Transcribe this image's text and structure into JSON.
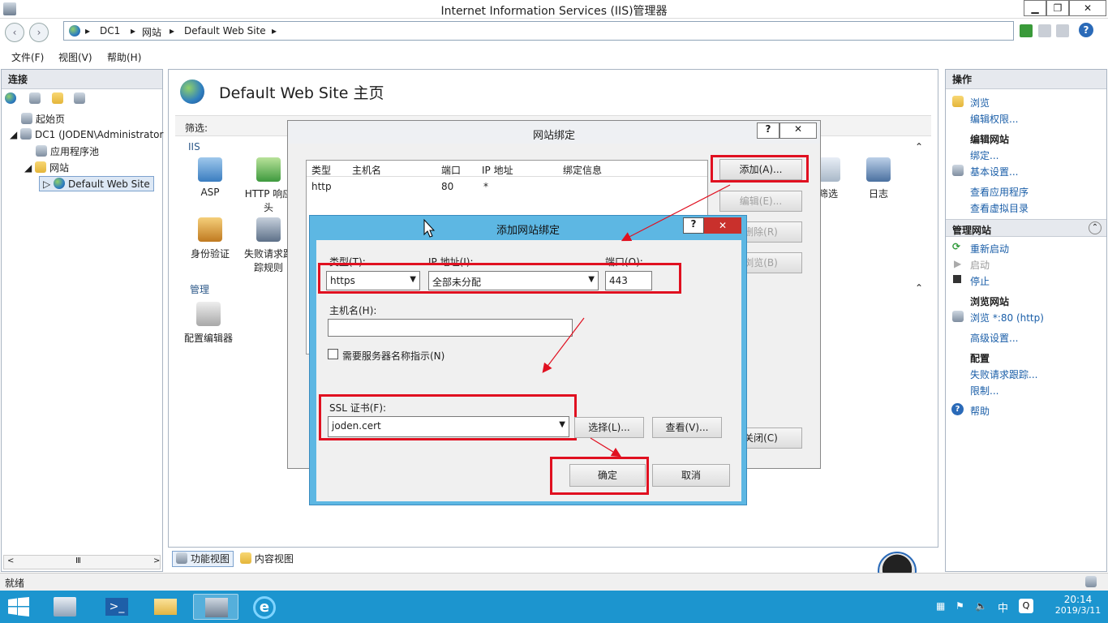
{
  "window": {
    "title": "Internet Information Services (IIS)管理器"
  },
  "address": {
    "crumbs": [
      "DC1",
      "网站",
      "Default Web Site"
    ]
  },
  "menu": [
    "文件(F)",
    "视图(V)",
    "帮助(H)"
  ],
  "left": {
    "header": "连接",
    "tree": [
      "起始页",
      "DC1 (JODEN\\Administrator",
      "应用程序池",
      "网站",
      "Default Web Site"
    ]
  },
  "center": {
    "title": "Default Web Site 主页",
    "filter_label": "筛选:",
    "section_iis": "IIS",
    "section_manage": "管理",
    "features": [
      "ASP",
      "HTTP 响应\n头",
      "身份验证",
      "失败请求跟\n踪规则",
      "配置编辑器",
      "筛选",
      "日志"
    ],
    "view_tabs": [
      "功能视图",
      "内容视图"
    ]
  },
  "right": {
    "header": "操作",
    "groups": [
      {
        "heading": "",
        "items": [
          "浏览",
          "编辑权限..."
        ]
      },
      {
        "heading": "编辑网站",
        "items": [
          "绑定...",
          "基本设置..."
        ]
      },
      {
        "heading": "",
        "items": [
          "查看应用程序",
          "查看虚拟目录"
        ]
      }
    ],
    "manage_header": "管理网站",
    "manage_items": [
      "重新启动",
      "启动",
      "停止"
    ],
    "browse_heading": "浏览网站",
    "browse_items": [
      "浏览 *:80 (http)"
    ],
    "advanced": "高级设置...",
    "config_heading": "配置",
    "config_items": [
      "失败请求跟踪...",
      "限制..."
    ],
    "help": "帮助"
  },
  "bindings_dialog": {
    "title": "网站绑定",
    "columns": [
      "类型",
      "主机名",
      "端口",
      "IP 地址",
      "绑定信息"
    ],
    "rows": [
      {
        "type": "http",
        "host": "",
        "port": "80",
        "ip": "*",
        "info": ""
      }
    ],
    "buttons": {
      "add": "添加(A)...",
      "edit": "编辑(E)...",
      "remove": "删除(R)",
      "browse": "浏览(B)",
      "close": "关闭(C)"
    }
  },
  "add_dialog": {
    "title": "添加网站绑定",
    "type_label": "类型(T):",
    "type_value": "https",
    "ip_label": "IP 地址(I):",
    "ip_value": "全部未分配",
    "port_label": "端口(O):",
    "port_value": "443",
    "host_label": "主机名(H):",
    "host_value": "",
    "sni_label": "需要服务器名称指示(N)",
    "ssl_label": "SSL 证书(F):",
    "ssl_value": "joden.cert",
    "select_button": "选择(L)...",
    "view_button": "查看(V)...",
    "ok_button": "确定",
    "cancel_button": "取消"
  },
  "status": {
    "text": "就绪"
  },
  "clock": {
    "time": "20:14",
    "date": "2019/3/11",
    "ime": "中"
  }
}
